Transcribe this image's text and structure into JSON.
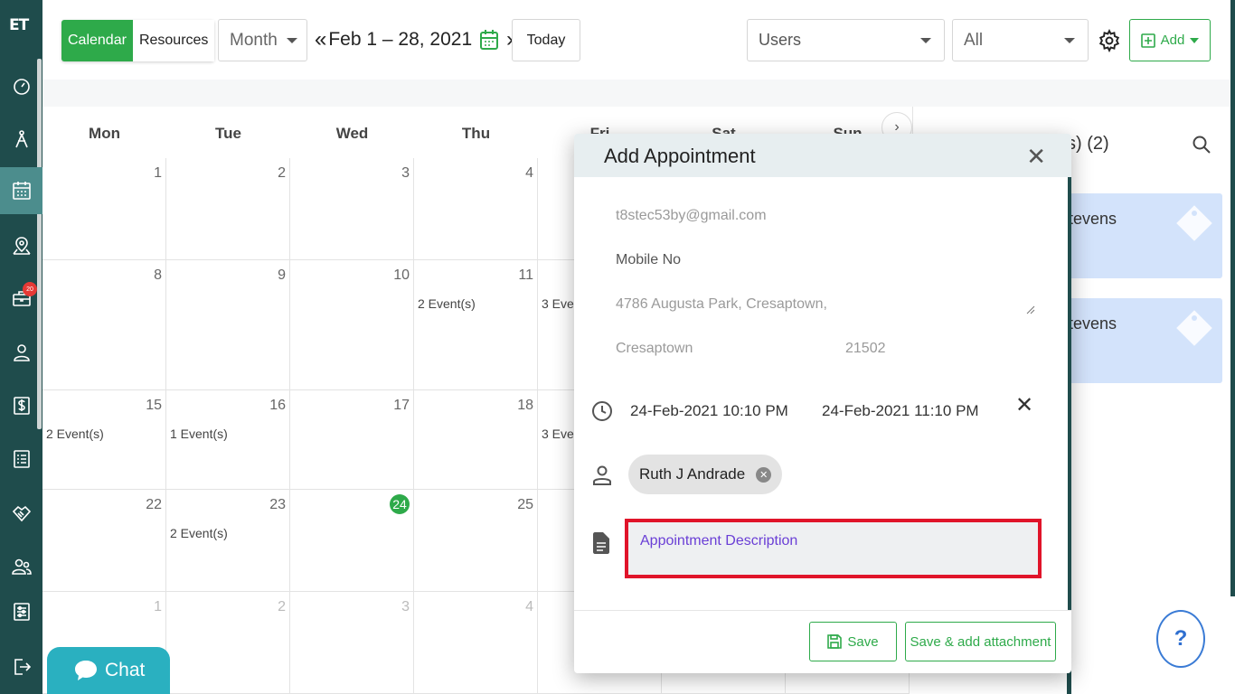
{
  "app": {
    "logo": "ET"
  },
  "sidebar": {
    "items": [
      {
        "icon": "dashboard-icon"
      },
      {
        "icon": "pin-tool-icon"
      },
      {
        "icon": "calendar-icon",
        "active": true
      },
      {
        "icon": "map-location-icon"
      },
      {
        "icon": "briefcase-icon",
        "badge": "20"
      },
      {
        "icon": "user-icon"
      },
      {
        "icon": "dollar-icon"
      },
      {
        "icon": "list-icon"
      },
      {
        "icon": "handshake-icon"
      },
      {
        "icon": "users-icon"
      },
      {
        "icon": "settings-sliders-icon"
      },
      {
        "icon": "logout-icon"
      }
    ]
  },
  "toolbar": {
    "calendar_label": "Calendar",
    "resources_label": "Resources",
    "view_select": "Month",
    "prev_glyph": "«",
    "next_glyph": "»",
    "date_range": "Feb 1 – 28, 2021",
    "today_label": "Today",
    "users_select": "Users",
    "filter_select": "All",
    "add_label": "Add"
  },
  "calendar": {
    "day_headers": [
      "Mon",
      "Tue",
      "Wed",
      "Thu",
      "Fri",
      "Sat",
      "Sun"
    ],
    "weeks": [
      [
        {
          "n": "1"
        },
        {
          "n": "2"
        },
        {
          "n": "3"
        },
        {
          "n": "4"
        }
      ],
      [
        {
          "n": "8"
        },
        {
          "n": "9"
        },
        {
          "n": "10"
        },
        {
          "n": "11",
          "ev": "2 Event(s)"
        },
        {
          "ev": "3 Even"
        }
      ],
      [
        {
          "n": "15",
          "ev": "2 Event(s)"
        },
        {
          "n": "16",
          "ev": "1 Event(s)"
        },
        {
          "n": "17"
        },
        {
          "n": "18"
        },
        {
          "ev": "3 Even"
        }
      ],
      [
        {
          "n": "22"
        },
        {
          "n": "23",
          "ev": "2 Event(s)"
        },
        {
          "n": "24",
          "today": true
        },
        {
          "n": "25"
        }
      ],
      [
        {
          "n": "1"
        },
        {
          "n": "2"
        },
        {
          "n": "3"
        },
        {
          "n": "4"
        }
      ]
    ]
  },
  "right_panel": {
    "title": "s) (2)",
    "cards": [
      {
        "name": "tevens"
      },
      {
        "name": "tevens"
      }
    ]
  },
  "modal": {
    "title": "Add Appointment",
    "email": "t8stec53by@gmail.com",
    "mobile_placeholder": "Mobile No",
    "address": "4786  Augusta Park, Cresaptown,",
    "city": "Cresaptown",
    "zip": "21502",
    "start": "24-Feb-2021 10:10 PM",
    "end": "24-Feb-2021 11:10 PM",
    "assignee": "Ruth J Andrade",
    "description_placeholder": "Appointment Description",
    "save_label": "Save",
    "save_attach_label": "Save & add attachment"
  },
  "chat": {
    "label": "Chat"
  },
  "help": {
    "label": "?"
  },
  "colors": {
    "brand_dark": "#1f4c4c",
    "accent_green": "#2eaa4a",
    "highlight_red": "#e0142a",
    "event_blue": "#d3e3fb"
  }
}
